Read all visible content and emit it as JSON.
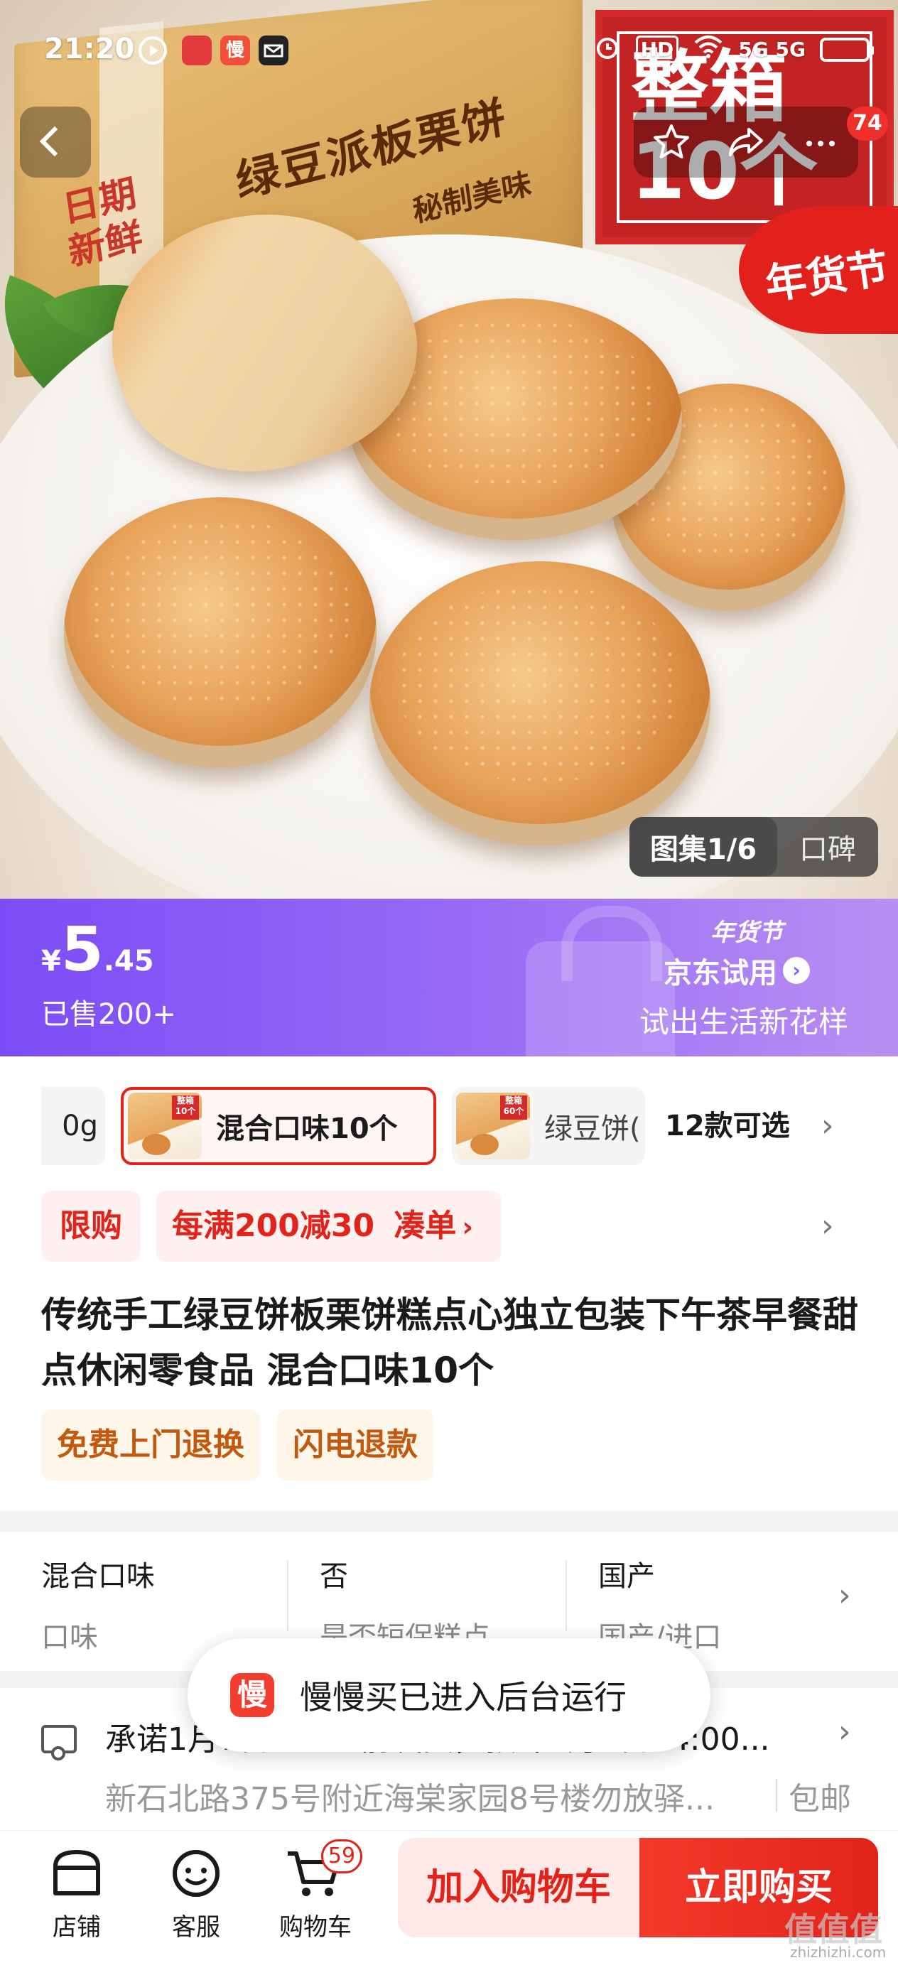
{
  "status_bar": {
    "time": "21:20",
    "network": "5G 5G",
    "hd": "HD"
  },
  "hero": {
    "box_title": "绿豆派板栗饼",
    "box_subtitle": "秘制美味",
    "box_stamp": "日期新鲜",
    "promo_big": "整箱10个",
    "promo_seal": "年货节",
    "message_badge": "74",
    "gallery_label": "图集1/6",
    "reviews_label": "口碑"
  },
  "price_band": {
    "currency": "¥",
    "price_int": "5",
    "price_dec": ".45",
    "sold": "已售200+",
    "trial_tag": "年货节",
    "trial_title": "京东试用",
    "trial_arrow": "›",
    "trial_slogan": "试出生活新花样",
    "gradient_start": "#7b4df6",
    "gradient_end": "#b98ff2"
  },
  "variants": {
    "prev_partial": "0g",
    "selected": {
      "label": "混合口味10个",
      "thumb_tag": "整箱10个"
    },
    "other": {
      "label": "绿豆饼(",
      "thumb_tag": "整箱60个"
    },
    "count": "12款可选",
    "more": "›"
  },
  "promo": {
    "limit": "限购",
    "deal": "每满200减30",
    "deal_action": "凑单",
    "deal_chevron": "›",
    "more": "›"
  },
  "product": {
    "title": "传统手工绿豆饼板栗饼糕点心独立包装下午茶早餐甜点休闲零食品 混合口味10个",
    "services": [
      "免费上门退换",
      "闪电退款"
    ]
  },
  "attributes": [
    {
      "value": "混合口味",
      "key": "口味"
    },
    {
      "value": "否",
      "key": "是否短保糕点"
    },
    {
      "value": "国产",
      "key": "国产/进口"
    }
  ],
  "attributes_more": "›",
  "delivery": {
    "promise": "承诺1月7日24:00前发货，预计1月9日24:00...",
    "address": "新石北路375号附近海棠家园8号楼勿放驿...",
    "shipping": "包邮",
    "more": "›"
  },
  "toast": {
    "logo": "慢",
    "message": "慢慢买已进入后台运行"
  },
  "bottom_bar": {
    "tabs": [
      {
        "label": "店铺"
      },
      {
        "label": "客服"
      },
      {
        "label": "购物车",
        "badge": "59"
      }
    ],
    "add_to_cart": "加入购物车",
    "buy_now": "立即购买",
    "accent": "#e2231a"
  },
  "watermark": {
    "big": "值值值",
    "small": "zhizhizhi.com"
  }
}
